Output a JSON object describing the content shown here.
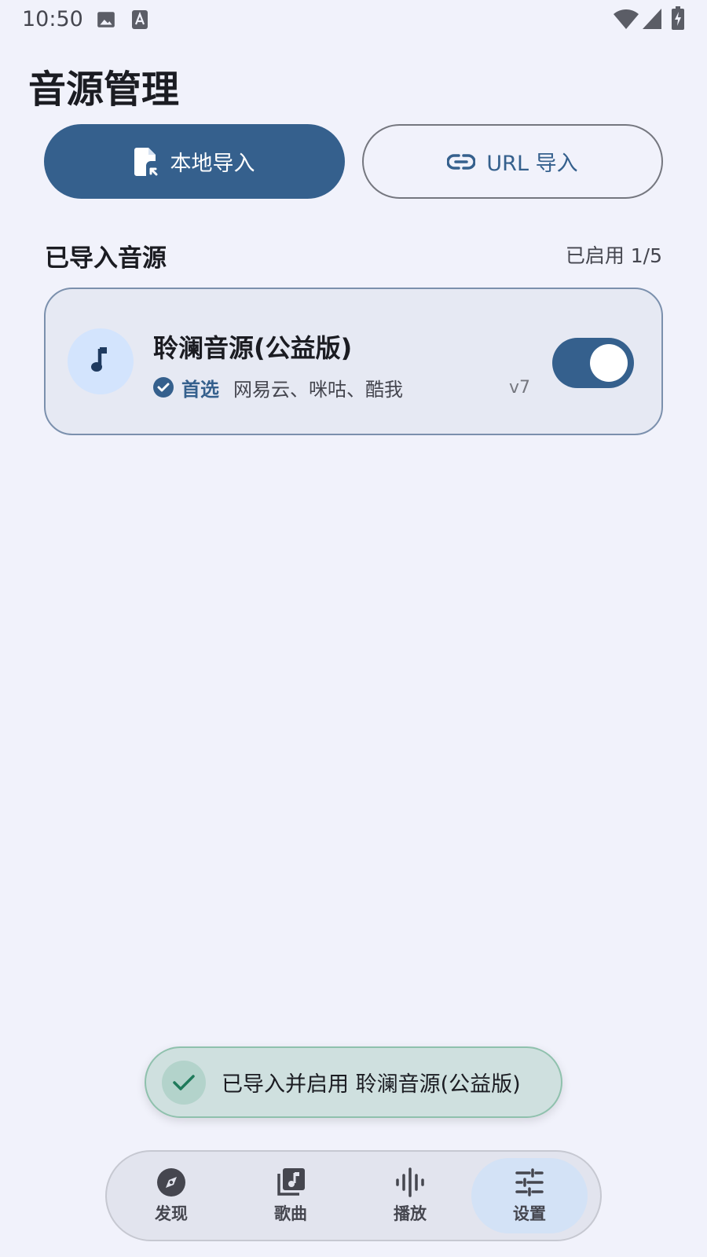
{
  "status_bar": {
    "time": "10:50"
  },
  "page": {
    "title": "音源管理"
  },
  "import_buttons": {
    "local_label": "本地导入",
    "url_label": "URL 导入"
  },
  "section": {
    "title": "已导入音源",
    "enabled_count": "已启用 1/5"
  },
  "sources": [
    {
      "name": "聆澜音源(公益版)",
      "preferred_label": "首选",
      "platforms": "网易云、咪咕、酷我",
      "version": "v7",
      "enabled": true
    }
  ],
  "snackbar": {
    "message": "已导入并启用 聆澜音源(公益版)"
  },
  "bottom_nav": {
    "items": [
      {
        "label": "发现",
        "icon": "compass-icon",
        "active": false
      },
      {
        "label": "歌曲",
        "icon": "music-library-icon",
        "active": false
      },
      {
        "label": "播放",
        "icon": "waveform-icon",
        "active": false
      },
      {
        "label": "设置",
        "icon": "sliders-icon",
        "active": true
      }
    ]
  },
  "colors": {
    "primary": "#35608d",
    "background": "#f1f2fb",
    "card": "#e6e9f3",
    "success": "#1f7a5a"
  }
}
